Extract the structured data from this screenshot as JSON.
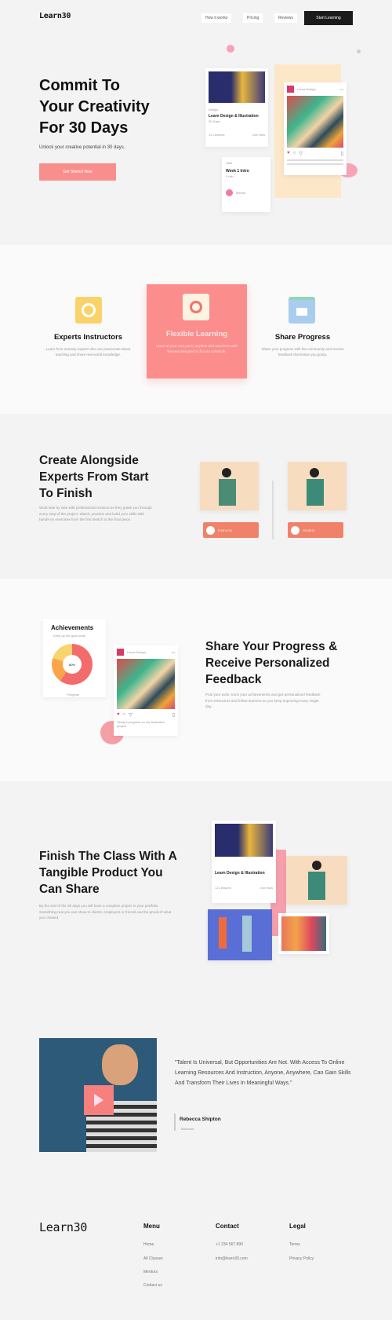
{
  "header": {
    "logo": "Learn30",
    "nav": [
      "How it works",
      "Pricing",
      "Reviews"
    ],
    "cta": "Start Learning"
  },
  "hero": {
    "title_lines": [
      "Commit To",
      "Your Creativity",
      "For 30 Days"
    ],
    "subtitle": "Unlock your creative potential in 30 days.",
    "cta": "Get Started Now",
    "course_card": {
      "tag": "Design",
      "title": "Learn Design & Illustration",
      "meta": "30 Days",
      "left": "12 Lessons",
      "right": "Join Now"
    },
    "social_card": {
      "user": "Laura Design"
    },
    "task_card": {
      "tag": "Task",
      "title": "Week 1 Intro",
      "meta": "5 min",
      "user": "Mentor"
    }
  },
  "features": [
    {
      "title": "Experts Instructors",
      "desc": "Learn from industry experts who are passionate about teaching and share real-world knowledge.",
      "icon": "instructor-icon",
      "highlight": false
    },
    {
      "title": "Flexible Learning",
      "desc": "Learn at your own pace, anytime and anywhere with lessons designed to fit your schedule.",
      "icon": "clock-icon",
      "highlight": true
    },
    {
      "title": "Share Progress",
      "desc": "Share your progress with the community and receive feedback that keeps you going.",
      "icon": "chat-icon",
      "highlight": false
    }
  ],
  "create": {
    "title_lines": [
      "Create Alongside",
      "Experts From Start",
      "To Finish"
    ],
    "body": "Work side by side with professional creators as they guide you through every step of the project. Watch, practice and build your skills with hands-on exercises from the first sketch to the final piece.",
    "chips": [
      "Instructor",
      "Student"
    ]
  },
  "progress": {
    "title_lines": [
      "Share Your Progress &",
      "Receive Personalized",
      "Feedback"
    ],
    "body": "Post your work, track your achievements and get personalized feedback from instructors and fellow learners so you keep improving every single day.",
    "achievements": {
      "title": "Achievements",
      "subtitle": "Keep up the good work",
      "center": "80%",
      "label": "Progress",
      "value": 0.8
    },
    "social_card": {
      "user": "Laura Design",
      "caption": "Today's progress on my illustration project"
    }
  },
  "finish": {
    "title_lines": [
      "Finish The Class With A",
      "Tangible Product You",
      "Can Share"
    ],
    "body": "By the end of the 30 days you will have a complete project in your portfolio. Something real you can show to clients, employers or friends and be proud of what you created.",
    "course_card": {
      "title": "Learn Design & Illustration",
      "left": "12 Lessons",
      "right": "Join Now"
    }
  },
  "testimonial": {
    "quote": "\"Talent Is Universal, But Opportunities Are Not. With Access To Online Learning Resources And Instruction, Anyone, Anywhere, Can Gain Skills And Transform Their Lives In Meaningful Ways.\"",
    "author": "Rebecca Shipton",
    "role": "Illustrator"
  },
  "footer": {
    "logo": "Learn30",
    "columns": [
      {
        "title": "Menu",
        "links": [
          "Home",
          "All Classes",
          "Mentors",
          "Contact us"
        ]
      },
      {
        "title": "Contact",
        "links": [
          "+1 234 567 890",
          "info@learn30.com"
        ]
      },
      {
        "title": "Legal",
        "links": [
          "Terms",
          "Privacy Policy"
        ]
      }
    ]
  },
  "colors": {
    "accent": "#f88f8d",
    "dark": "#1b1b1b",
    "bg": "#f3f3f3"
  }
}
